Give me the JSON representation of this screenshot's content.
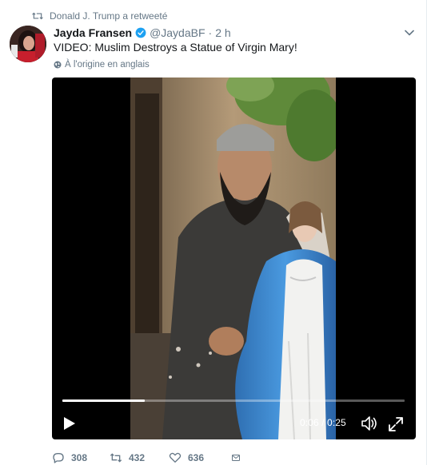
{
  "retweet_context": {
    "text": "Donald J. Trump a retweeté",
    "icon": "retweet-icon"
  },
  "author": {
    "name": "Jayda Fransen",
    "handle": "@JaydaBF",
    "separator": "·",
    "time": "2 h",
    "verified_icon": "verified-badge-icon"
  },
  "tweet": {
    "text": "VIDEO: Muslim Destroys a Statue of Virgin Mary!",
    "translate_label": "À l'origine en anglais"
  },
  "video": {
    "current_time": "0:06",
    "time_separator": "/",
    "duration": "0:25",
    "timer_text": "0:06 / 0:25",
    "progress": 0.24
  },
  "actions": {
    "reply_count": "308",
    "retweet_count": "432",
    "like_count": "636"
  },
  "colors": {
    "muted": "#657786",
    "verified": "#1da1f2",
    "text": "#14171a"
  }
}
